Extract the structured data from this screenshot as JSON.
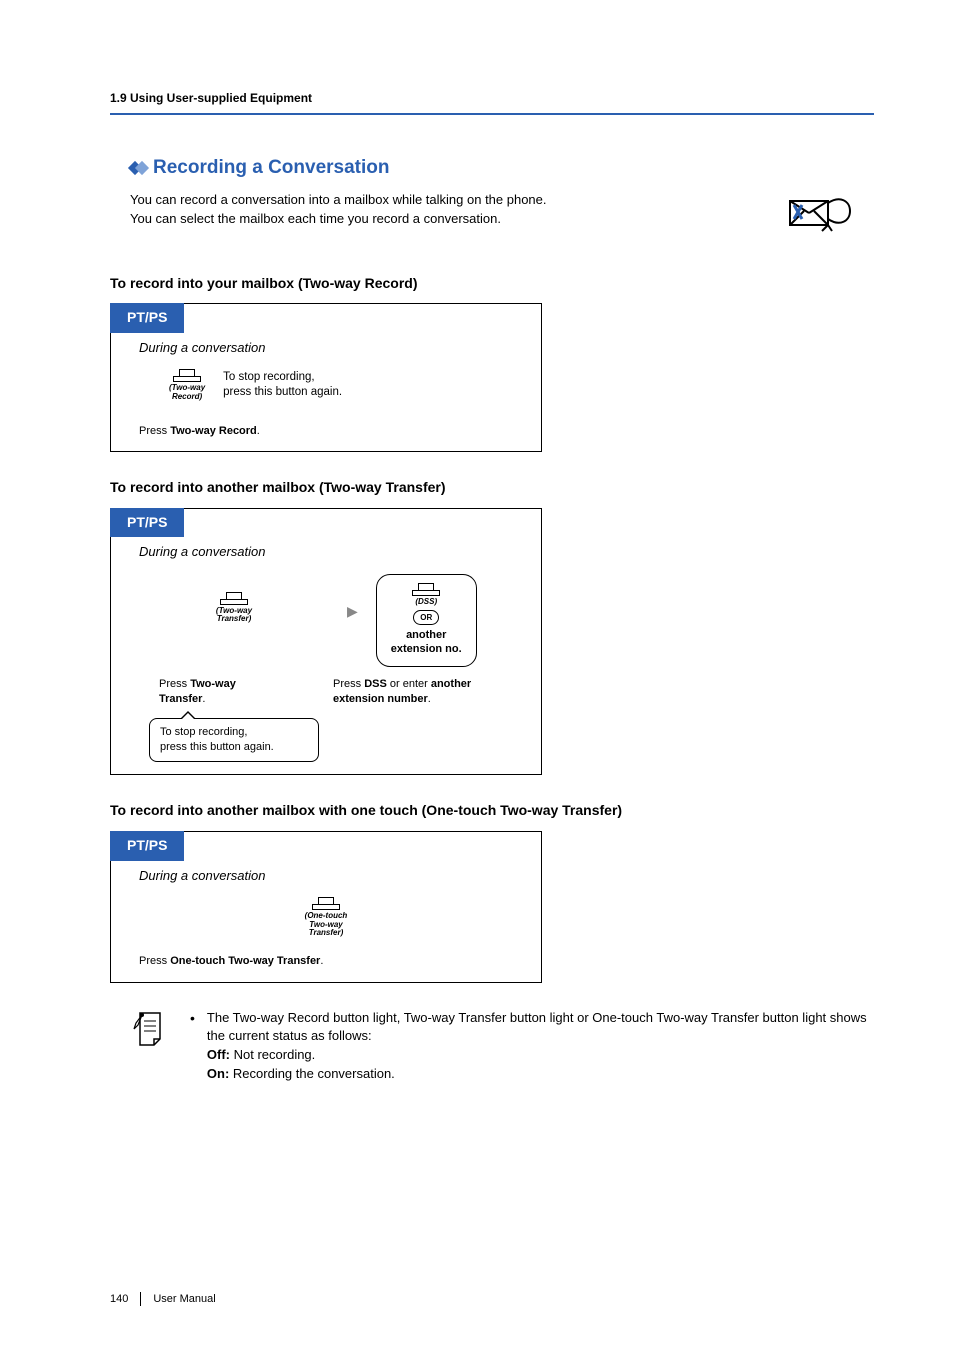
{
  "breadcrumb": "1.9 Using User-supplied Equipment",
  "section_title": "Recording a Conversation",
  "intro_line1": "You can record a conversation into a mailbox while talking on the phone.",
  "intro_line2": "You can select the mailbox each time you record a conversation.",
  "procedures": {
    "record_own": {
      "heading": "To record into your mailbox (Two-way Record)",
      "tab": "PT/PS",
      "pre": "During a conversation",
      "button_label_line1": "(Two-way",
      "button_label_line2": "Record)",
      "side_note_l1": "To stop recording,",
      "side_note_l2": "press this button again.",
      "caption_prefix": "Press ",
      "caption_bold": "Two-way Record",
      "caption_suffix": "."
    },
    "record_other": {
      "heading": "To record into another mailbox (Two-way Transfer)",
      "tab": "PT/PS",
      "pre": "During a conversation",
      "button1_label_line1": "(Two-way",
      "button1_label_line2": "Transfer)",
      "group_dss": "(DSS)",
      "group_or": "OR",
      "group_text_l1": "another",
      "group_text_l2": "extension no.",
      "caption1_prefix": "Press ",
      "caption1_bold": "Two-way Transfer",
      "caption1_suffix": ".",
      "caption2_p1": "Press ",
      "caption2_b1": "DSS",
      "caption2_p2": " or enter ",
      "caption2_b2": "another extension number",
      "caption2_suffix": ".",
      "speech_l1": "To stop recording,",
      "speech_l2": "press this button again."
    },
    "record_onetouch": {
      "heading": "To record into another mailbox with one touch (One-touch Two-way Transfer)",
      "tab": "PT/PS",
      "pre": "During a conversation",
      "button_label_line1": "(One-touch",
      "button_label_line2": "Two-way",
      "button_label_line3": "Transfer)",
      "caption_prefix": "Press ",
      "caption_bold": "One-touch Two-way Transfer",
      "caption_suffix": "."
    }
  },
  "notes": {
    "line1": "The Two-way Record button light, Two-way Transfer button light or One-touch Two-way Transfer button light shows the current status as follows:",
    "off_label": "Off:",
    "off_text": " Not recording.",
    "on_label": "On:",
    "on_text": " Recording the conversation."
  },
  "footer": {
    "page": "140",
    "label": "User Manual"
  }
}
